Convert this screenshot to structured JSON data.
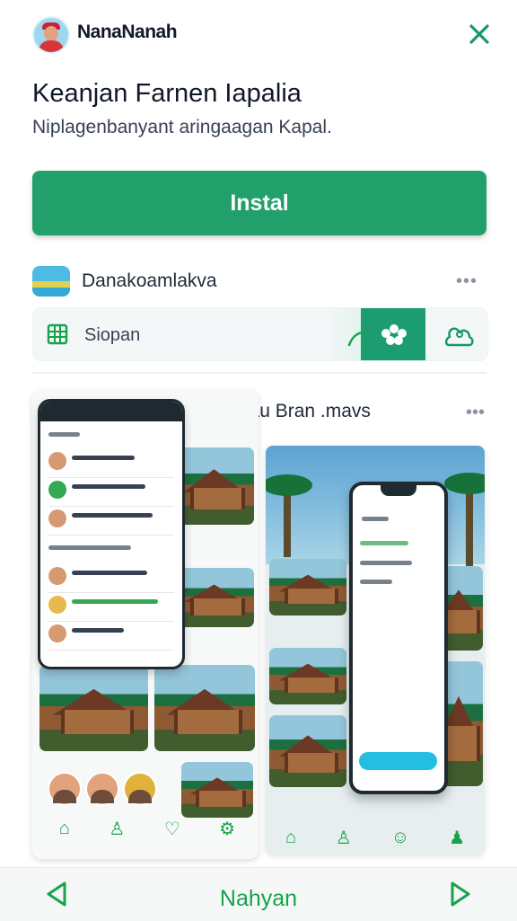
{
  "header": {
    "brand": "NanaNanah",
    "close_icon": "close-icon",
    "avatar_icon": "avatar-icon"
  },
  "main": {
    "title": "Keanjan Farnen Iapalia",
    "subtitle": "Niplagenbanyant aringaagan Kapal.",
    "install_label": "Instal"
  },
  "source": {
    "name": "Danakoamlakva",
    "menu_icon": "more-icon"
  },
  "toolbar": {
    "item_label": "Siopan",
    "icons": [
      "grid-icon",
      "share-icon",
      "people-cluster-icon",
      "cloud-profile-icon"
    ]
  },
  "gallery": {
    "header": "Uattau Bran .mavs",
    "more_icon": "more-icon"
  },
  "footer": {
    "label": "Nahyan",
    "prev_icon": "chevron-left-icon",
    "next_icon": "chevron-right-icon"
  },
  "colors": {
    "accent": "#22a06b",
    "nav_green": "#16a34a",
    "text": "#111827"
  }
}
